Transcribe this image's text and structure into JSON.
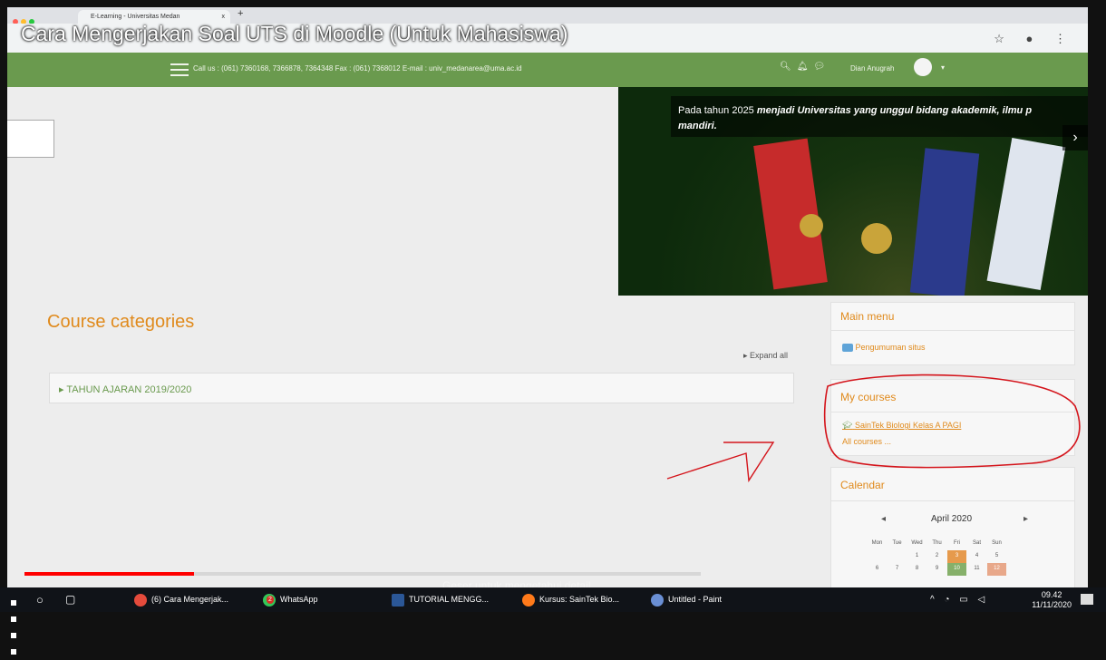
{
  "browser": {
    "tab_title": "E-Learning - Universitas Medan",
    "tab_close": "x",
    "new_tab": "+"
  },
  "video": {
    "title": "Cara Mengerjakan Soal UTS di Moodle (Untuk Mahasiswa)",
    "progress": 0.25,
    "caption": "Geser untuk mengetahui detail"
  },
  "header": {
    "contact": "Call us : (061) 7360168, 7366878, 7364348 Fax : (061) 7368012 E-mail : univ_medanarea@uma.ac.id",
    "user_name": "Dian Anugrah"
  },
  "banner": {
    "text_plain": "Pada tahun 2025 ",
    "text_bold": "menjadi Universitas yang unggul bidang akademik, ilmu p",
    "text_line2": "mandiri."
  },
  "main": {
    "title": "Course categories",
    "expand_all": "Expand all",
    "category": "TAHUN AJARAN 2019/2020"
  },
  "blocks": {
    "main_menu": {
      "title": "Main menu",
      "item": "Pengumuman situs"
    },
    "my_courses": {
      "title": "My courses",
      "course": "SainTek Biologi Kelas A PAGI",
      "all": "All courses ..."
    },
    "calendar": {
      "title": "Calendar",
      "month": "April 2020",
      "prev": "◂",
      "next": "▸",
      "days": [
        "Mon",
        "Tue",
        "Wed",
        "Thu",
        "Fri",
        "Sat",
        "Sun"
      ],
      "row1": [
        "",
        "",
        "1",
        "2",
        "3",
        "4",
        "5"
      ],
      "row2": [
        "6",
        "7",
        "8",
        "9",
        "10",
        "11",
        "12"
      ]
    }
  },
  "taskbar": {
    "items": [
      "(6) Cara Mengerjak...",
      "WhatsApp",
      "TUTORIAL MENGG...",
      "Kursus: SainTek Bio...",
      "Untitled - Paint"
    ],
    "whatsapp_badge": "2",
    "time": "09.42",
    "date": "11/11/2020"
  },
  "colors": {
    "header_green": "#6a9a4e",
    "accent_orange": "#e08a1c",
    "annotation_red": "#d4141b"
  }
}
